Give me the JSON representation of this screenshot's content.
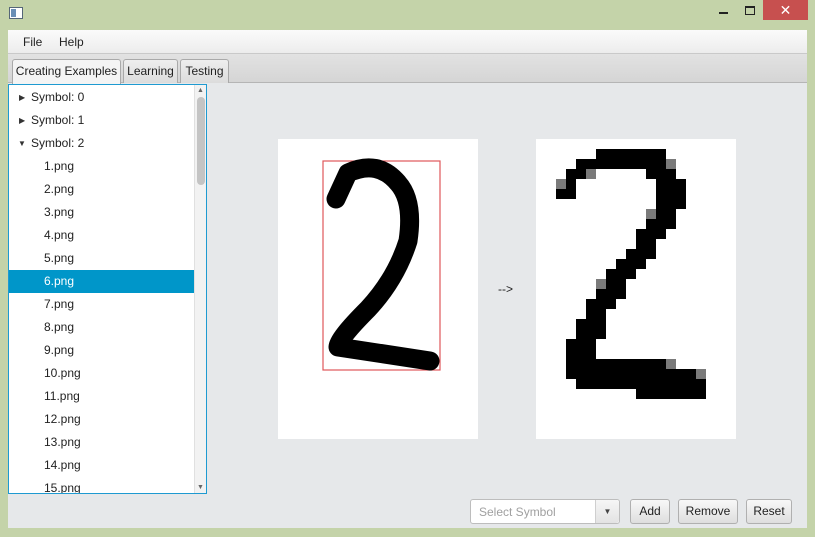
{
  "menubar": {
    "file": "File",
    "help": "Help"
  },
  "tabs": [
    {
      "label": "Creating Examples"
    },
    {
      "label": "Learning"
    },
    {
      "label": "Testing"
    }
  ],
  "tree": {
    "items": [
      {
        "label": "Symbol: 0"
      },
      {
        "label": "Symbol: 1"
      },
      {
        "label": "Symbol: 2"
      },
      {
        "label": "1.png"
      },
      {
        "label": "2.png"
      },
      {
        "label": "3.png"
      },
      {
        "label": "4.png"
      },
      {
        "label": "5.png"
      },
      {
        "label": "6.png"
      },
      {
        "label": "7.png"
      },
      {
        "label": "8.png"
      },
      {
        "label": "9.png"
      },
      {
        "label": "10.png"
      },
      {
        "label": "11.png"
      },
      {
        "label": "12.png"
      },
      {
        "label": "13.png"
      },
      {
        "label": "14.png"
      },
      {
        "label": "15.png"
      }
    ],
    "selected": "6.png"
  },
  "preview": {
    "arrow": "-->"
  },
  "controls": {
    "symbol_placeholder": "Select Symbol",
    "add": "Add",
    "remove": "Remove",
    "reset": "Reset"
  },
  "colors": {
    "accent": "#0096c9",
    "bounding_box": "#e0575a",
    "close_button": "#c7504f"
  }
}
